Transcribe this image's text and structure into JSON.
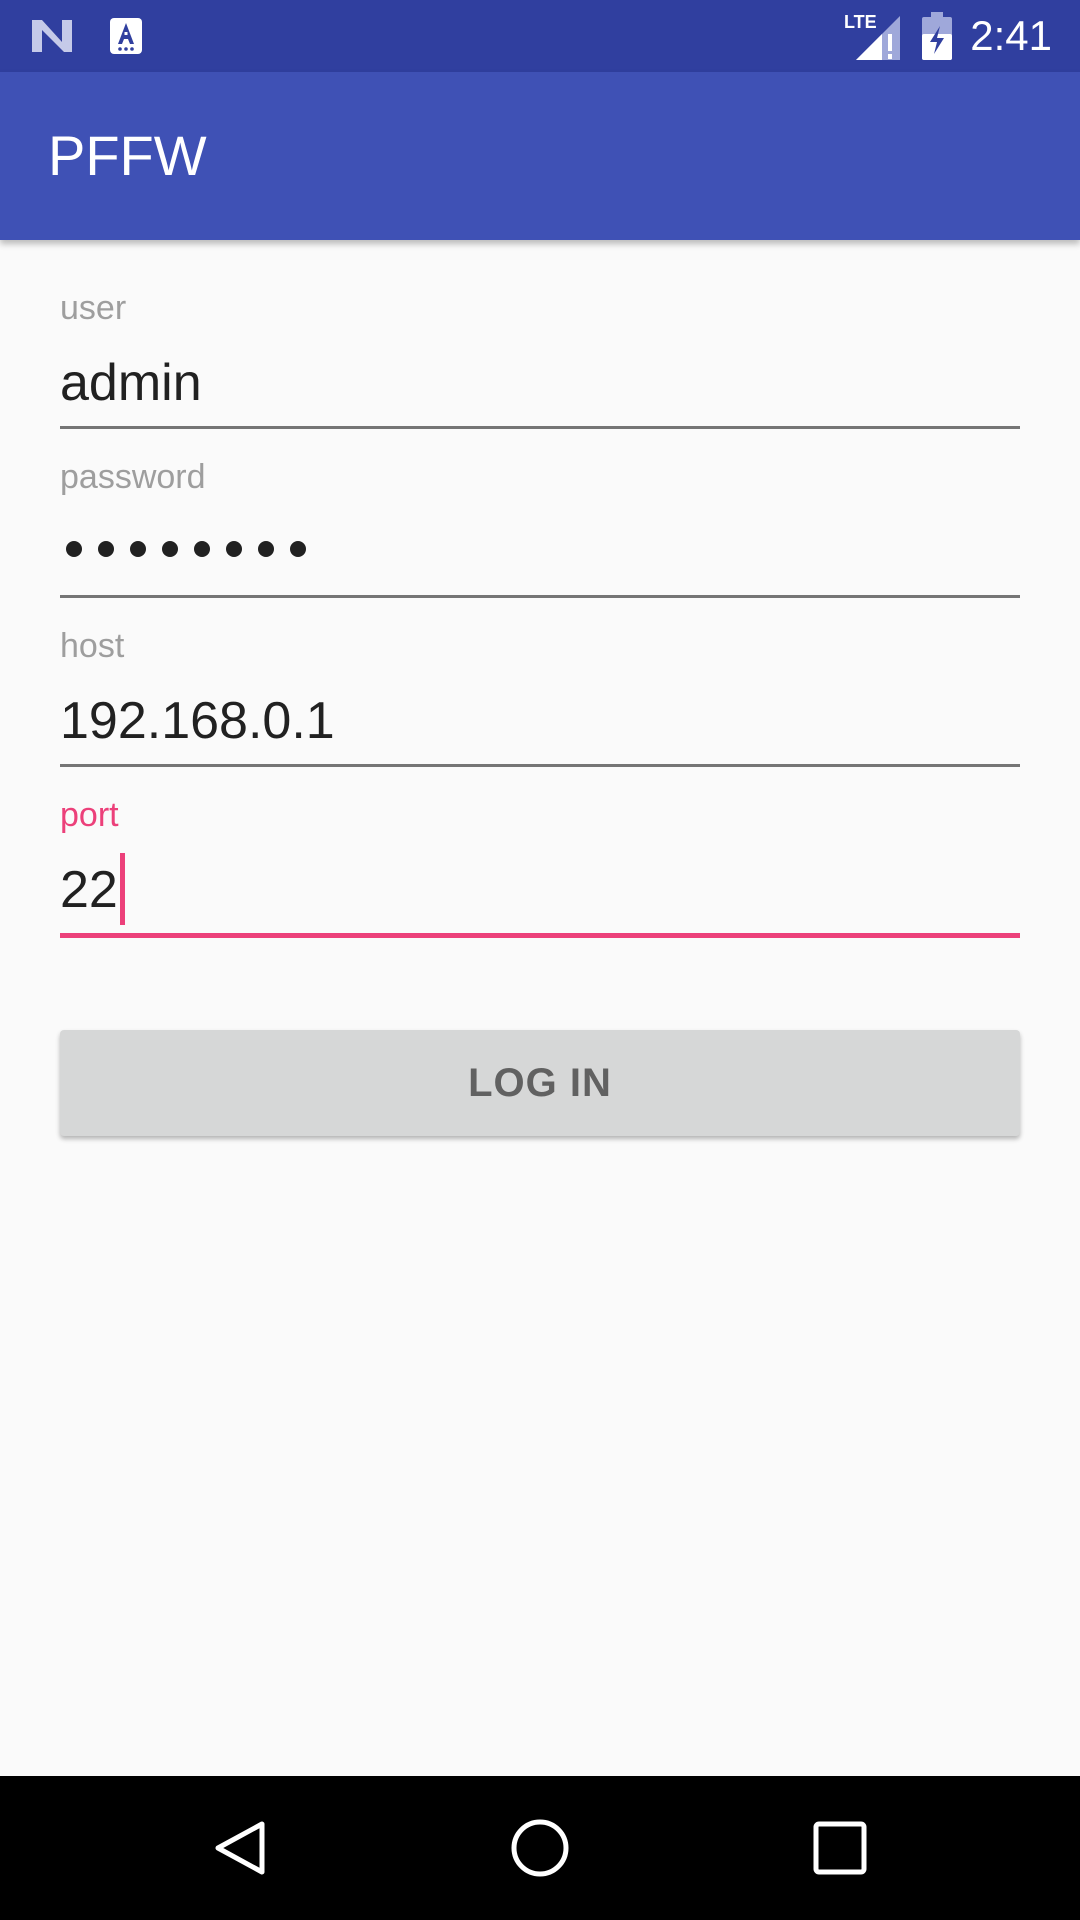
{
  "status_bar": {
    "time": "2:41",
    "network_label": "LTE",
    "icons": [
      "n-notification-icon",
      "text-a-notification-icon",
      "lte-signal-icon",
      "battery-charging-icon"
    ]
  },
  "app_bar": {
    "title": "PFFW"
  },
  "form": {
    "user": {
      "label": "user",
      "value": "admin"
    },
    "password": {
      "label": "password",
      "masked_length": 8
    },
    "host": {
      "label": "host",
      "value": "192.168.0.1"
    },
    "port": {
      "label": "port",
      "value": "22",
      "focused": true
    }
  },
  "login_button": {
    "label": "LOG IN"
  },
  "nav_bar": {
    "icons": [
      "back-icon",
      "home-icon",
      "recents-icon"
    ]
  },
  "colors": {
    "status_bar": "#303f9f",
    "app_bar": "#3f51b5",
    "accent": "#ec407a",
    "background": "#fafafa",
    "button": "#d6d7d7"
  }
}
